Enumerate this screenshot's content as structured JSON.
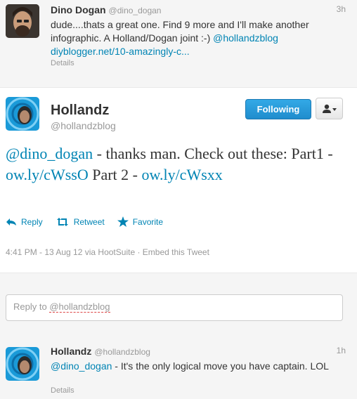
{
  "tweet1": {
    "name": "Dino Dogan",
    "handle": "@dino_dogan",
    "time": "3h",
    "text_before": "dude....thats a great one. Find 9 more and I'll make another infographic. A Holland/Dogan joint :-) ",
    "mention": "@hollandzblog",
    "url": "diyblogger.net/10-amazingly-c...",
    "details": "Details"
  },
  "main": {
    "name": "Hollandz",
    "handle": "@hollandzblog",
    "follow_label": "Following",
    "mention": "@dino_dogan",
    "text_mid": " - thanks man. Check out these: Part1 - ",
    "link1": "ow.ly/cWssO",
    "text_part2": " Part 2 - ",
    "link2": "ow.ly/cWsxx",
    "actions": {
      "reply": "Reply",
      "retweet": "Retweet",
      "favorite": "Favorite"
    },
    "meta": "4:41 PM - 13 Aug 12 via HootSuite · Embed this Tweet"
  },
  "reply": {
    "prefix": "Reply to ",
    "handle": "@hollandzblog"
  },
  "tweet3": {
    "name": "Hollandz",
    "handle": "@hollandzblog",
    "time": "1h",
    "mention": "@dino_dogan",
    "text_rest": " - It's the only logical move you have captain. LOL",
    "details": "Details"
  }
}
